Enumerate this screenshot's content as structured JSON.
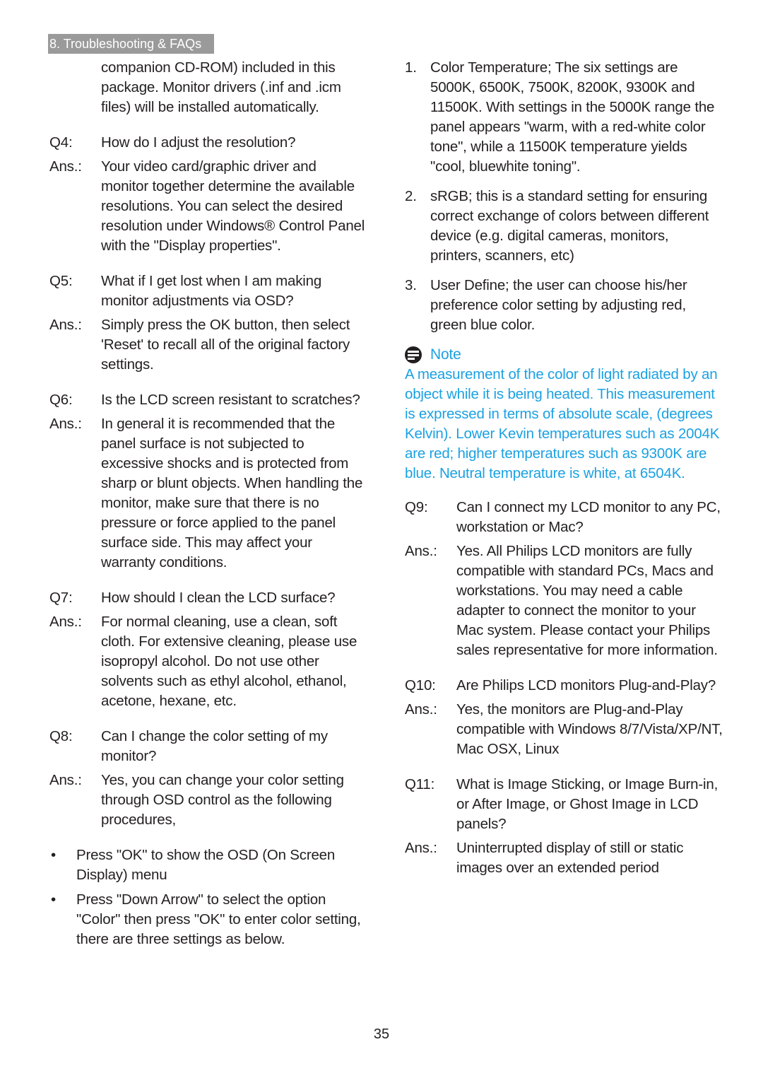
{
  "header": {
    "section_tab": "8. Troubleshooting & FAQs"
  },
  "left": {
    "intro": "companion CD-ROM) included in this package. Monitor drivers (.inf and .icm files) will be installed automatically.",
    "qa": [
      {
        "q_label": "Q4:",
        "q": "How do I adjust the resolution?",
        "a_label": "Ans.:",
        "a": "Your video card/graphic driver and monitor together determine the available resolutions. You can select the desired resolution under Windows® Control Panel with the \"Display properties\"."
      },
      {
        "q_label": "Q5:",
        "q": "What if I get lost when I am making monitor adjustments via OSD?",
        "a_label": "Ans.:",
        "a": "Simply press the OK button, then select 'Reset' to recall all of the original factory settings."
      },
      {
        "q_label": "Q6:",
        "q": "Is the LCD screen resistant to scratches?",
        "a_label": "Ans.:",
        "a": "In general it is recommended that the panel surface is not subjected to excessive shocks and is protected from sharp or blunt objects. When handling the monitor, make sure that there is no pressure or force applied to the panel surface side. This may affect your warranty conditions."
      },
      {
        "q_label": "Q7:",
        "q": "How should I clean the LCD surface?",
        "a_label": "Ans.:",
        "a": "For normal cleaning, use a clean, soft cloth. For extensive cleaning, please use isopropyl alcohol. Do not use other solvents such as ethyl alcohol, ethanol, acetone, hexane, etc."
      },
      {
        "q_label": "Q8:",
        "q": "Can I change the color setting of my monitor?",
        "a_label": "Ans.:",
        "a": "Yes, you can change your color setting through OSD control as the following procedures,"
      }
    ],
    "bullets": [
      "Press \"OK\" to show the OSD (On Screen Display) menu",
      "Press \"Down Arrow\" to select the option \"Color\" then press \"OK\" to enter color setting, there are three settings as below."
    ],
    "bullet_symbol": "•"
  },
  "right": {
    "numbered": [
      {
        "n": "1.",
        "text": "Color Temperature; The six settings are 5000K, 6500K, 7500K, 8200K, 9300K and 11500K. With settings in the 5000K range the panel appears \"warm, with a red-white color tone\", while a 11500K temperature yields \"cool, bluewhite toning\"."
      },
      {
        "n": "2.",
        "text": "sRGB; this is a standard setting for ensuring correct exchange of colors between different device (e.g. digital cameras, monitors, printers, scanners, etc)"
      },
      {
        "n": "3.",
        "text": "User Define; the user can choose his/her preference color setting by adjusting red, green blue color."
      }
    ],
    "note": {
      "icon": "note-icon",
      "title": "Note",
      "body": "A measurement of the color of light radiated by an object while it is being heated. This measurement is expressed in terms of absolute scale, (degrees Kelvin). Lower Kevin temperatures such as 2004K are red; higher temperatures such as 9300K are blue. Neutral temperature is white, at 6504K.",
      "color": "#1ba1e2"
    },
    "qa": [
      {
        "q_label": "Q9:",
        "q": "Can I connect my LCD monitor to any PC, workstation or Mac?",
        "a_label": "Ans.:",
        "a": "Yes. All Philips LCD monitors are fully compatible with standard PCs, Macs and workstations. You may need a cable adapter to connect the monitor to your Mac system. Please contact your Philips sales representative for more information."
      },
      {
        "q_label": "Q10:",
        "q": "Are Philips LCD monitors Plug-and-Play?",
        "a_label": "Ans.:",
        "a": "Yes, the monitors are Plug-and-Play compatible with Windows 8/7/Vista/XP/NT, Mac OSX, Linux"
      },
      {
        "q_label": "Q11:",
        "q": "What is Image Sticking, or Image Burn-in, or After Image, or Ghost Image in LCD panels?",
        "a_label": "Ans.:",
        "a": "Uninterrupted display of still or static images over an extended period"
      }
    ]
  },
  "footer": {
    "page_number": "35"
  }
}
